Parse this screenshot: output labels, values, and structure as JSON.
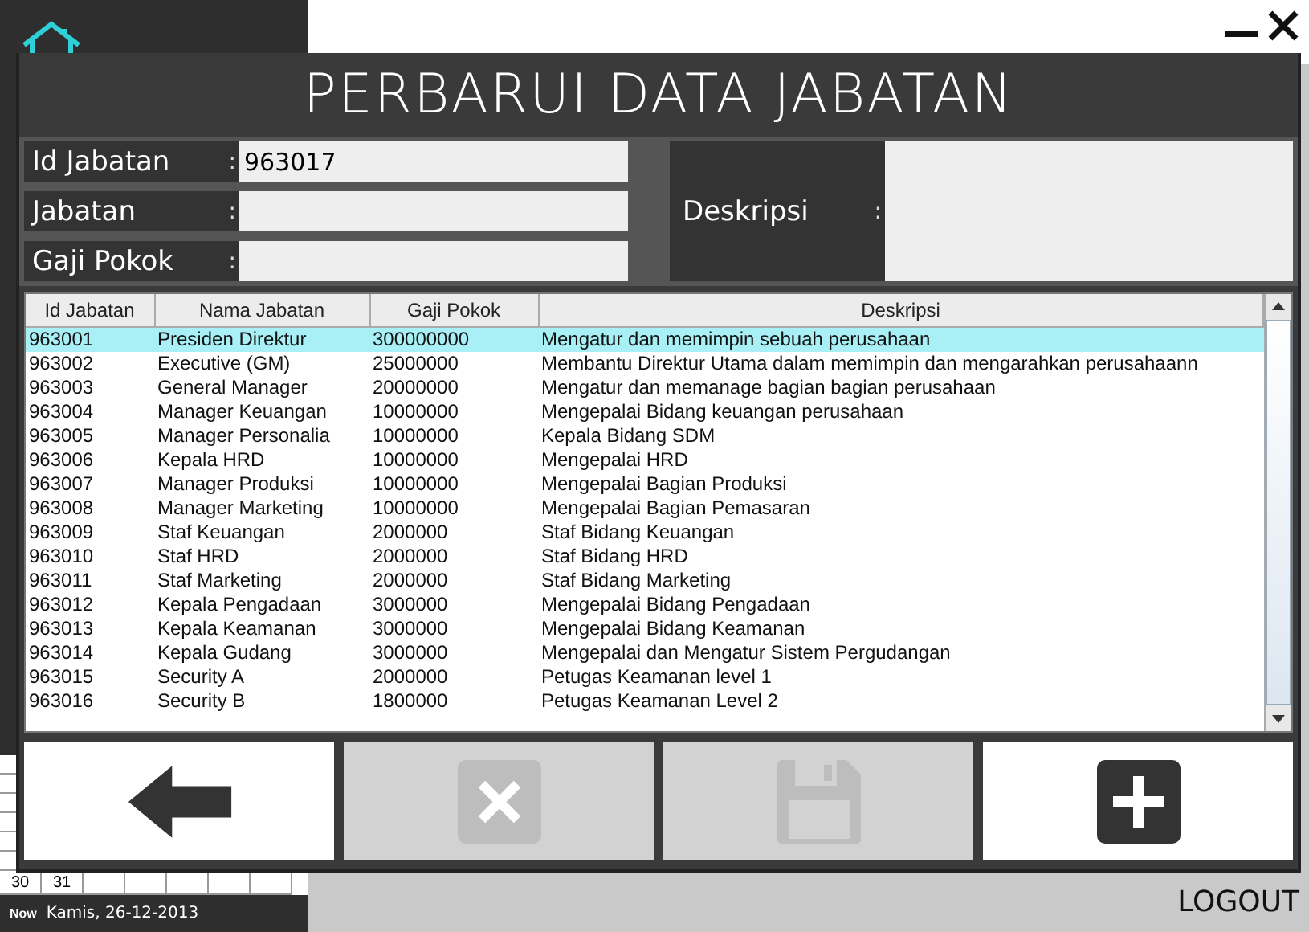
{
  "calendar": {
    "days": [
      "30",
      "31"
    ],
    "now_label": "Now",
    "now_date": "Kamis, 26-12-2013"
  },
  "logout": "LOGOUT",
  "dialog": {
    "title": "PERBARUI DATA JABATAN",
    "fields": [
      {
        "label": "Id Jabatan",
        "separator": ":",
        "value": "963017"
      },
      {
        "label": "Jabatan",
        "separator": ":"
      },
      {
        "label": "Gaji Pokok",
        "separator": ":"
      }
    ],
    "description": {
      "label": "Deskripsi",
      "separator": ":"
    },
    "table": {
      "columns": [
        "Id Jabatan",
        "Nama Jabatan",
        "Gaji Pokok",
        "Deskripsi"
      ],
      "rows": [
        {
          "cells": [
            "963001",
            "Presiden Direktur",
            "300000000",
            "Mengatur dan memimpin sebuah perusahaan"
          ],
          "selected": true
        },
        {
          "cells": [
            "963002",
            "Executive (GM)",
            "25000000",
            "Membantu Direktur Utama dalam memimpin dan mengarahkan perusahaann"
          ],
          "selected": false
        },
        {
          "cells": [
            "963003",
            "General Manager",
            "20000000",
            "Mengatur dan memanage bagian bagian perusahaan"
          ],
          "selected": false
        },
        {
          "cells": [
            "963004",
            "Manager Keuangan",
            "10000000",
            "Mengepalai Bidang keuangan perusahaan"
          ],
          "selected": false
        },
        {
          "cells": [
            "963005",
            "Manager Personalia",
            "10000000",
            "Kepala Bidang SDM"
          ],
          "selected": false
        },
        {
          "cells": [
            "963006",
            "Kepala HRD",
            "10000000",
            "Mengepalai HRD"
          ],
          "selected": false
        },
        {
          "cells": [
            "963007",
            "Manager Produksi",
            "10000000",
            "Mengepalai Bagian Produksi"
          ],
          "selected": false
        },
        {
          "cells": [
            "963008",
            "Manager Marketing",
            "10000000",
            "Mengepalai Bagian Pemasaran"
          ],
          "selected": false
        },
        {
          "cells": [
            "963009",
            "Staf Keuangan",
            "2000000",
            "Staf Bidang Keuangan"
          ],
          "selected": false
        },
        {
          "cells": [
            "963010",
            "Staf HRD",
            "2000000",
            "Staf Bidang HRD"
          ],
          "selected": false
        },
        {
          "cells": [
            "963011",
            "Staf Marketing",
            "2000000",
            "Staf Bidang Marketing"
          ],
          "selected": false
        },
        {
          "cells": [
            "963012",
            "Kepala Pengadaan",
            "3000000",
            "Mengepalai Bidang Pengadaan"
          ],
          "selected": false
        },
        {
          "cells": [
            "963013",
            "Kepala Keamanan",
            "3000000",
            "Mengepalai Bidang Keamanan"
          ],
          "selected": false
        },
        {
          "cells": [
            "963014",
            "Kepala Gudang",
            "3000000",
            "Mengepalai dan Mengatur Sistem Pergudangan"
          ],
          "selected": false
        },
        {
          "cells": [
            "963015",
            "Security A",
            "2000000",
            "Petugas Keamanan level 1"
          ],
          "selected": false
        },
        {
          "cells": [
            "963016",
            "Security B",
            "1800000",
            "Petugas Keamanan Level 2"
          ],
          "selected": false
        }
      ]
    },
    "buttons": [
      {
        "kind": "back",
        "disabled": false
      },
      {
        "kind": "delete",
        "disabled": true
      },
      {
        "kind": "save",
        "disabled": true
      },
      {
        "kind": "add",
        "disabled": false
      }
    ]
  }
}
